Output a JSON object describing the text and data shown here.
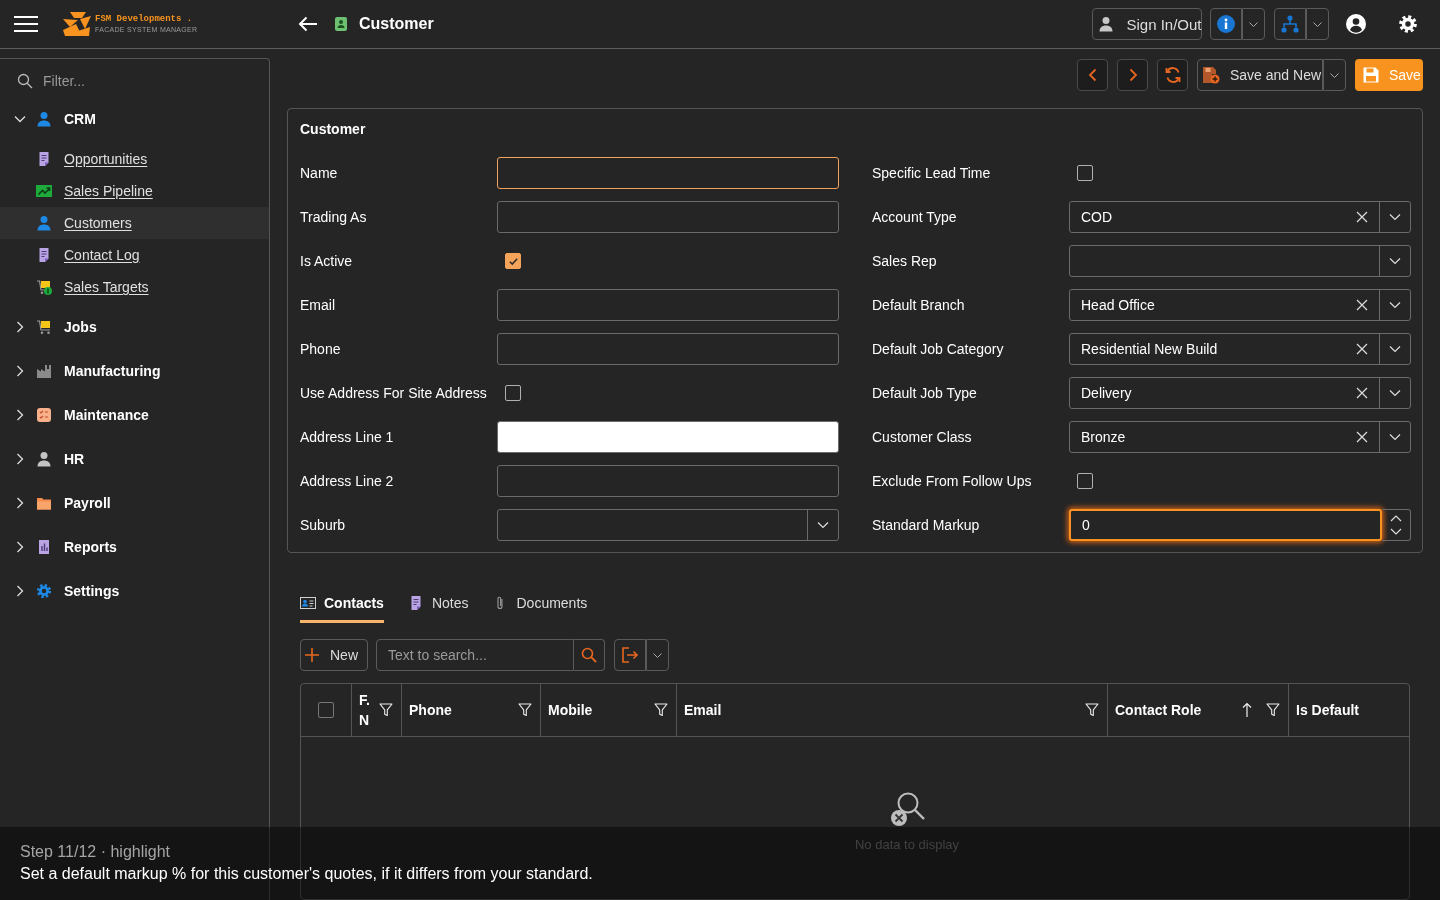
{
  "header": {
    "logo": {
      "name": "FSM Developments .",
      "tagline": "FACADE SYSTEM MANAGER"
    },
    "page_title": "Customer",
    "sign_in_button": "Sign In/Out"
  },
  "sidebar": {
    "filter": {
      "placeholder": "Filter..."
    },
    "groups": [
      {
        "label": "CRM",
        "expanded": true,
        "children": [
          {
            "label": "Opportunities",
            "selected": false
          },
          {
            "label": "Sales Pipeline",
            "selected": false
          },
          {
            "label": "Customers",
            "selected": true
          },
          {
            "label": "Contact Log",
            "selected": false
          },
          {
            "label": "Sales Targets",
            "selected": false
          }
        ]
      },
      {
        "label": "Jobs",
        "expanded": false
      },
      {
        "label": "Manufacturing",
        "expanded": false
      },
      {
        "label": "Maintenance",
        "expanded": false
      },
      {
        "label": "HR",
        "expanded": false
      },
      {
        "label": "Payroll",
        "expanded": false
      },
      {
        "label": "Reports",
        "expanded": false
      },
      {
        "label": "Settings",
        "expanded": false
      }
    ]
  },
  "toolbar": {
    "save_and_new_button": "Save and New",
    "save_button": "Save"
  },
  "form": {
    "title": "Customer",
    "left_fields": [
      {
        "label": "Name",
        "kind": "text",
        "focused": true,
        "autofilled": false,
        "highlighted": false
      },
      {
        "label": "Trading As",
        "kind": "text",
        "focused": false,
        "autofilled": false,
        "highlighted": false
      },
      {
        "label": "Is Active",
        "kind": "checkbox",
        "checked": true,
        "highlighted": false
      },
      {
        "label": "Email",
        "kind": "text",
        "focused": false,
        "autofilled": false,
        "highlighted": false
      },
      {
        "label": "Phone",
        "kind": "text",
        "focused": false,
        "autofilled": false,
        "highlighted": false
      },
      {
        "label": "Use Address For Site Address",
        "kind": "checkbox",
        "checked": false,
        "highlighted": false
      },
      {
        "label": "Address Line 1",
        "kind": "text",
        "focused": false,
        "autofilled": true,
        "highlighted": false
      },
      {
        "label": "Address Line 2",
        "kind": "text",
        "focused": false,
        "autofilled": false,
        "highlighted": false
      },
      {
        "label": "Suburb",
        "kind": "dropdown",
        "highlighted": false
      }
    ],
    "right_fields": [
      {
        "label": "Specific Lead Time",
        "kind": "checkbox",
        "checked": false,
        "highlighted": false
      },
      {
        "label": "Account Type",
        "kind": "dropdown",
        "value": "COD",
        "highlighted": false
      },
      {
        "label": "Sales Rep",
        "kind": "dropdown",
        "highlighted": false
      },
      {
        "label": "Default Branch",
        "kind": "dropdown",
        "value": "Head Office",
        "highlighted": false
      },
      {
        "label": "Default Job Category",
        "kind": "dropdown",
        "value": "Residential New Build",
        "highlighted": false
      },
      {
        "label": "Default Job Type",
        "kind": "dropdown",
        "value": "Delivery",
        "highlighted": false
      },
      {
        "label": "Customer Class",
        "kind": "dropdown",
        "value": "Bronze",
        "highlighted": false
      },
      {
        "label": "Exclude From Follow Ups",
        "kind": "checkbox",
        "checked": false,
        "highlighted": false
      },
      {
        "label": "Standard Markup",
        "kind": "number",
        "value": "0",
        "highlighted": true
      }
    ]
  },
  "tabs": [
    {
      "label": "Contacts",
      "selected": true
    },
    {
      "label": "Notes",
      "selected": false
    },
    {
      "label": "Documents",
      "selected": false
    }
  ],
  "contacts_grid": {
    "new_button": "New",
    "search": {
      "placeholder": "Text to search..."
    },
    "header_checkbox": {
      "checked": false
    },
    "columns": [
      {
        "label": "F. N",
        "filter": true,
        "sorted_ascending": false
      },
      {
        "label": "Phone",
        "filter": true,
        "sorted_ascending": false
      },
      {
        "label": "Mobile",
        "filter": true,
        "sorted_ascending": false
      },
      {
        "label": "Email",
        "filter": true,
        "sorted_ascending": false
      },
      {
        "label": "Contact Role",
        "filter": true,
        "sorted_ascending": true
      },
      {
        "label": "Is Default",
        "filter": false,
        "sorted_ascending": false
      }
    ],
    "empty_message": "No data to display"
  },
  "tour": {
    "step": "Step 11/12 · highlight",
    "message": "Set a default markup % for this customer's quotes, if it differs from your standard."
  }
}
